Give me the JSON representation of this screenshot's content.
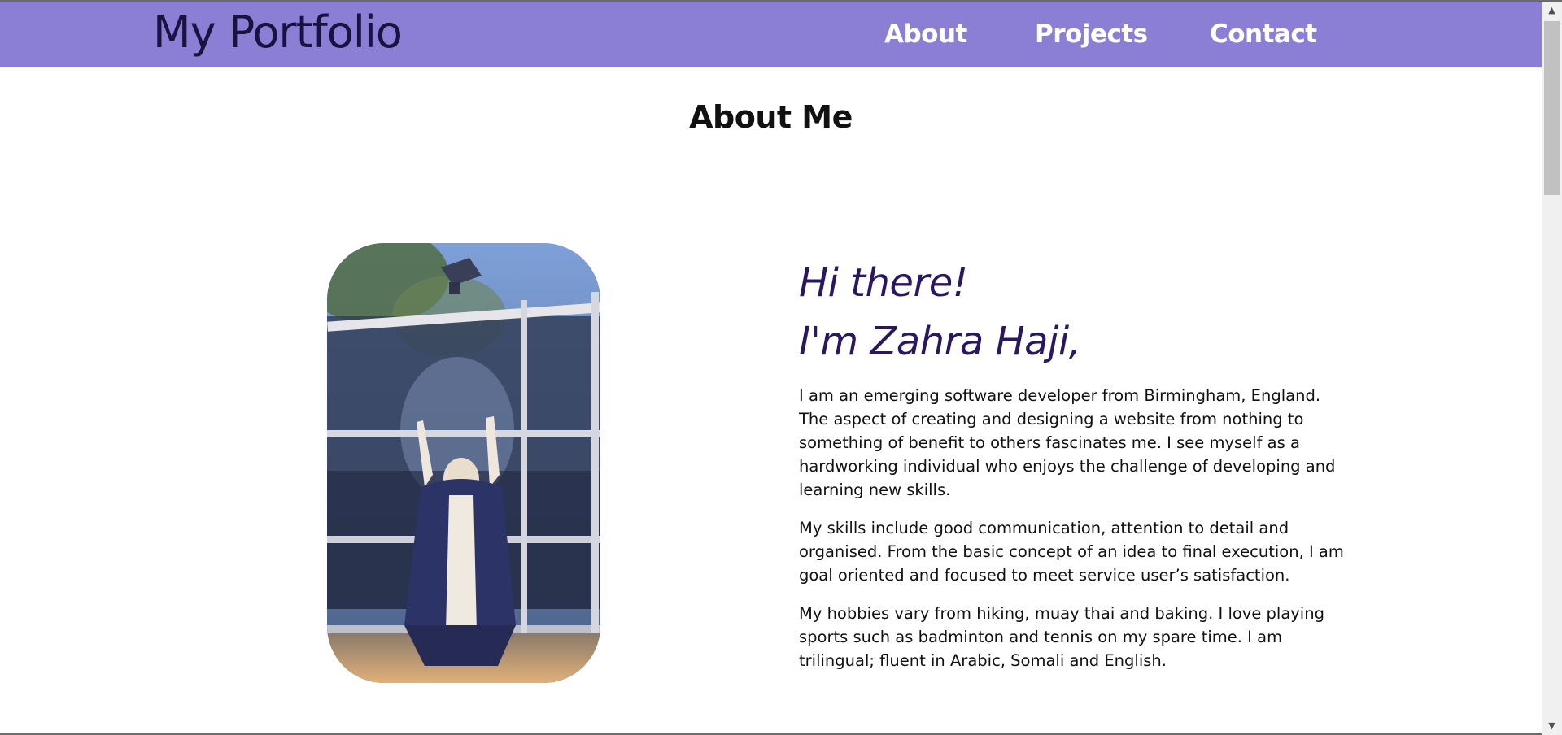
{
  "header": {
    "logo": "My Portfolio",
    "nav": [
      {
        "label": "About"
      },
      {
        "label": "Projects"
      },
      {
        "label": "Contact"
      }
    ],
    "bg_color": "#8a7fd4"
  },
  "about": {
    "title": "About Me",
    "greeting_line1": "Hi there!",
    "greeting_line2": "I'm Zahra Haji,",
    "paragraphs": [
      "I am an emerging software developer from Birmingham, England. The aspect of creating and designing a website from nothing to something of benefit to others fascinates me. I see myself as a hardworking individual who enjoys the challenge of developing and learning new skills.",
      "My skills include good communication, attention to detail and organised. From the basic concept of an idea to final execution, I am goal oriented and focused to meet service user’s satisfaction.",
      "My hobbies vary from hiking, muay thai and baking. I love playing sports such as badminton and tennis on my spare time. I am trilingual; fluent in Arabic, Somali and English."
    ],
    "photo_icon": "graduation-photo"
  },
  "scrollbar": {
    "up_icon": "scroll-up-arrow",
    "down_icon": "scroll-down-arrow"
  }
}
